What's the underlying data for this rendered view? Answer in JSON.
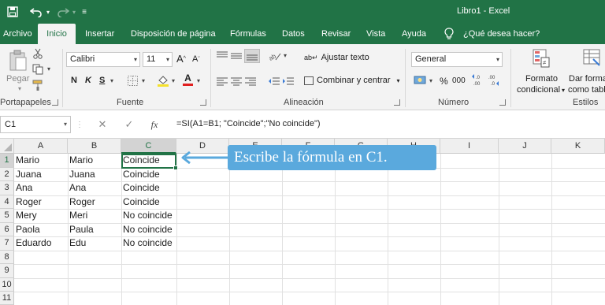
{
  "window": {
    "title": "Libro1  -  Excel"
  },
  "ribbon": {
    "tabs": [
      "Archivo",
      "Inicio",
      "Insertar",
      "Disposición de página",
      "Fórmulas",
      "Datos",
      "Revisar",
      "Vista",
      "Ayuda"
    ],
    "active_tab": "Inicio",
    "search_label": "¿Qué desea hacer?",
    "clipboard": {
      "paste_label": "Pegar",
      "group_label": "Portapapeles"
    },
    "font": {
      "font_name": "Calibri",
      "font_size": "11",
      "bold": "N",
      "italic": "K",
      "underline": "S",
      "grow": "A",
      "shrink": "A",
      "color_letter": "A",
      "group_label": "Fuente"
    },
    "alignment": {
      "wrap_label": "Ajustar texto",
      "merge_label": "Combinar y centrar",
      "group_label": "Alineación"
    },
    "number": {
      "format": "General",
      "percent": "%",
      "thousands": "000",
      "decimals_up": ",0 .00",
      "group_label": "Número"
    },
    "styles": {
      "cond_format_line1": "Formato",
      "cond_format_line2": "condicional",
      "table_format_line1": "Dar forma",
      "table_format_line2": "como tabl",
      "group_label": "Estilos"
    }
  },
  "formula_bar": {
    "name_box": "C1",
    "fx": "fx",
    "cancel": "✕",
    "enter": "✓",
    "formula": "=SI(A1=B1; \"Coincide\";\"No coincide\")"
  },
  "sheet": {
    "columns": [
      "A",
      "B",
      "C",
      "D",
      "E",
      "F",
      "G",
      "H",
      "I",
      "J",
      "K"
    ],
    "selected_column": "C",
    "row_numbers": [
      "1",
      "2",
      "3",
      "4",
      "5",
      "6",
      "7",
      "8",
      "9",
      "10",
      "11"
    ],
    "rows": [
      [
        "Mario",
        "Mario",
        "Coincide"
      ],
      [
        "Juana",
        "Juana",
        "Coincide"
      ],
      [
        "Ana",
        "Ana",
        "Coincide"
      ],
      [
        "Roger",
        "Roger",
        "Coincide"
      ],
      [
        "Mery",
        "Meri",
        "No coincide"
      ],
      [
        "Paola",
        "Paula",
        "No coincide"
      ],
      [
        "Eduardo",
        "Edu",
        "No coincide"
      ]
    ],
    "selected_cell": "C1"
  },
  "annotation": {
    "text": "Escribe la fórmula en C1.",
    "color": "#5aa9dd"
  },
  "colors": {
    "excel_green": "#217346",
    "ribbon_bg": "#f3f3f3"
  }
}
